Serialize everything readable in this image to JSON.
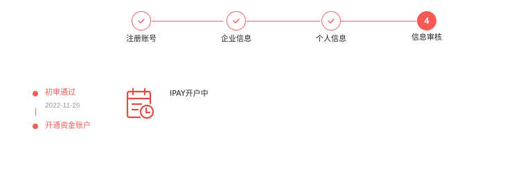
{
  "colors": {
    "accent": "#f0605a",
    "active_step": "#f55a55",
    "text": "#222222",
    "muted": "#999999"
  },
  "steps": [
    {
      "label": "注册账号",
      "state": "done",
      "icon": "check-icon"
    },
    {
      "label": "企业信息",
      "state": "done",
      "icon": "check-icon"
    },
    {
      "label": "个人信息",
      "state": "done",
      "icon": "check-icon"
    },
    {
      "label": "信息审核",
      "state": "active",
      "number": "4"
    }
  ],
  "timeline": {
    "items": [
      {
        "title": "初审通过",
        "date": "2022-11-26"
      },
      {
        "title": "开通资金账户"
      }
    ]
  },
  "status": {
    "icon": "calendar-clock-icon",
    "text": "IPAY开户中"
  }
}
